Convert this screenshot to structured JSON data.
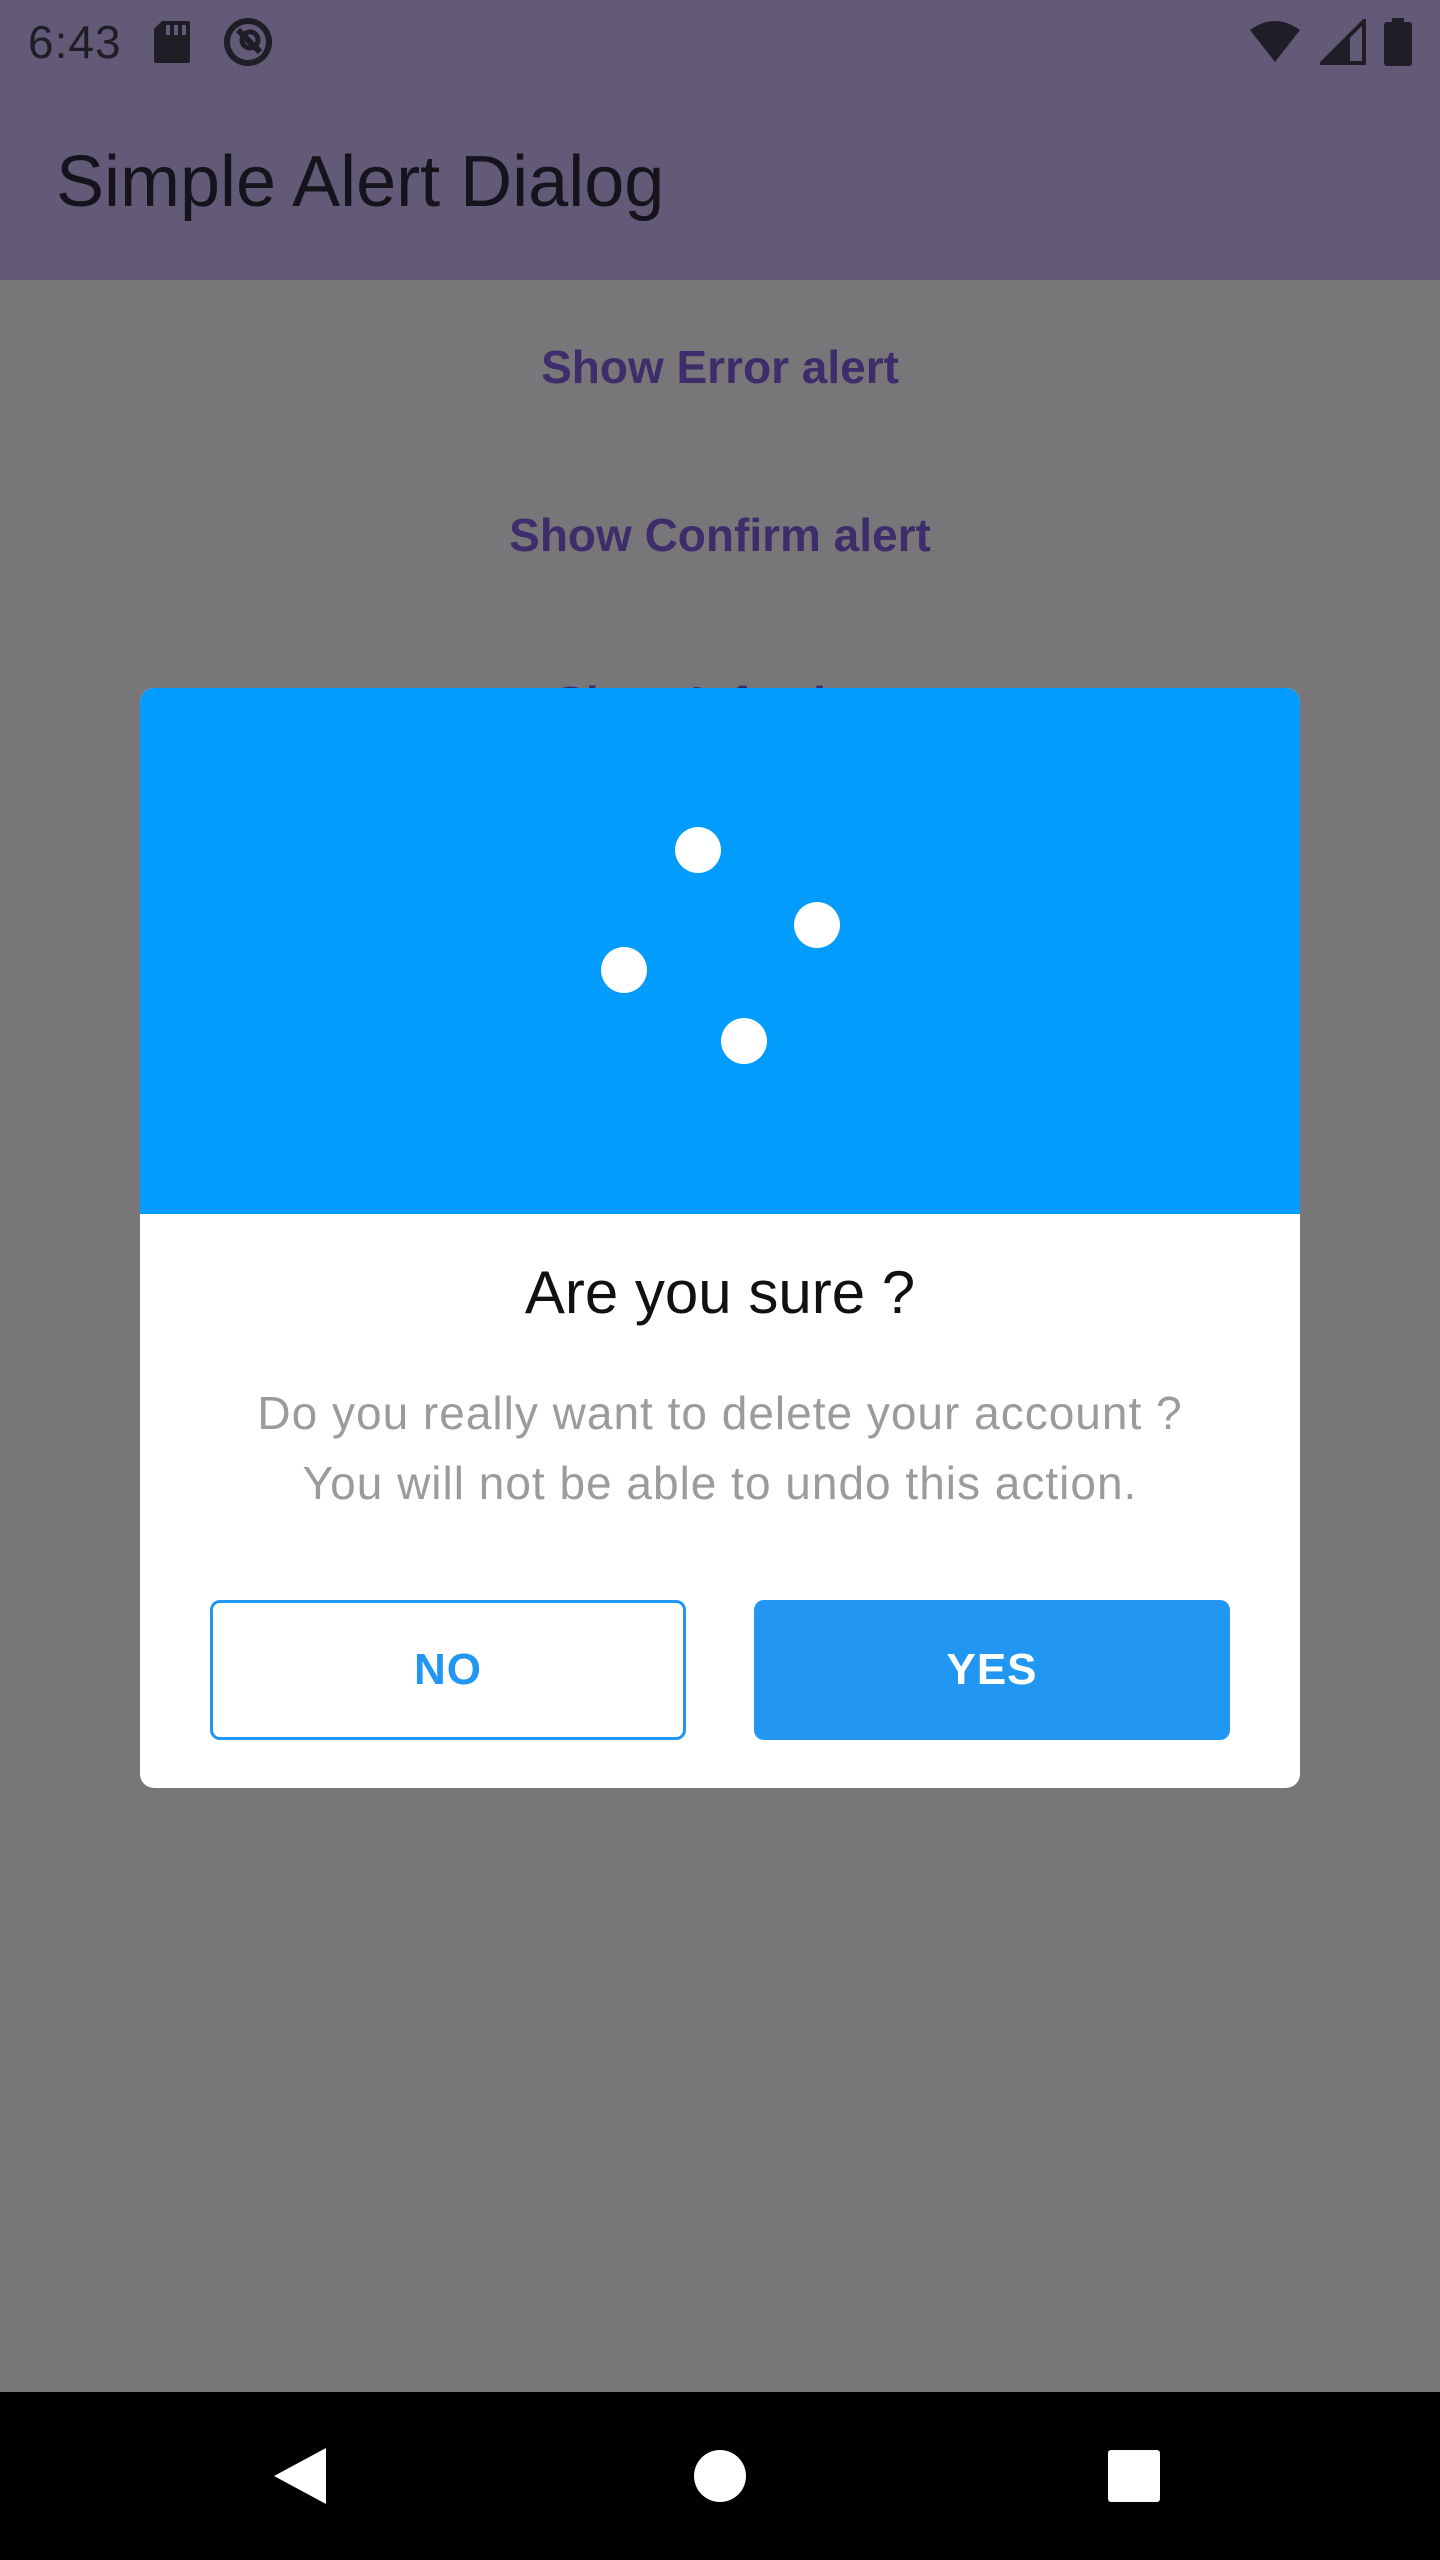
{
  "status_bar": {
    "time": "6:43",
    "icons": [
      "sd-card-icon",
      "do-not-disturb-icon",
      "wifi-icon",
      "cell-signal-icon",
      "battery-icon"
    ]
  },
  "app_bar": {
    "title": "Simple Alert Dialog"
  },
  "background_links": [
    {
      "label": "Show Error alert"
    },
    {
      "label": "Show Confirm alert"
    },
    {
      "label": "Show Info alert"
    }
  ],
  "dialog": {
    "header_color": "#029dfc",
    "header_icon": "loading-dots-icon",
    "title": "Are you sure ?",
    "message_line_1": "Do you really want to delete your account ?",
    "message_line_2": "You will not be able to undo this action.",
    "no_label": "NO",
    "yes_label": "YES",
    "button_color": "#2196f3"
  },
  "nav_bar": {
    "icons": [
      "back-icon",
      "home-icon",
      "recents-icon"
    ]
  }
}
